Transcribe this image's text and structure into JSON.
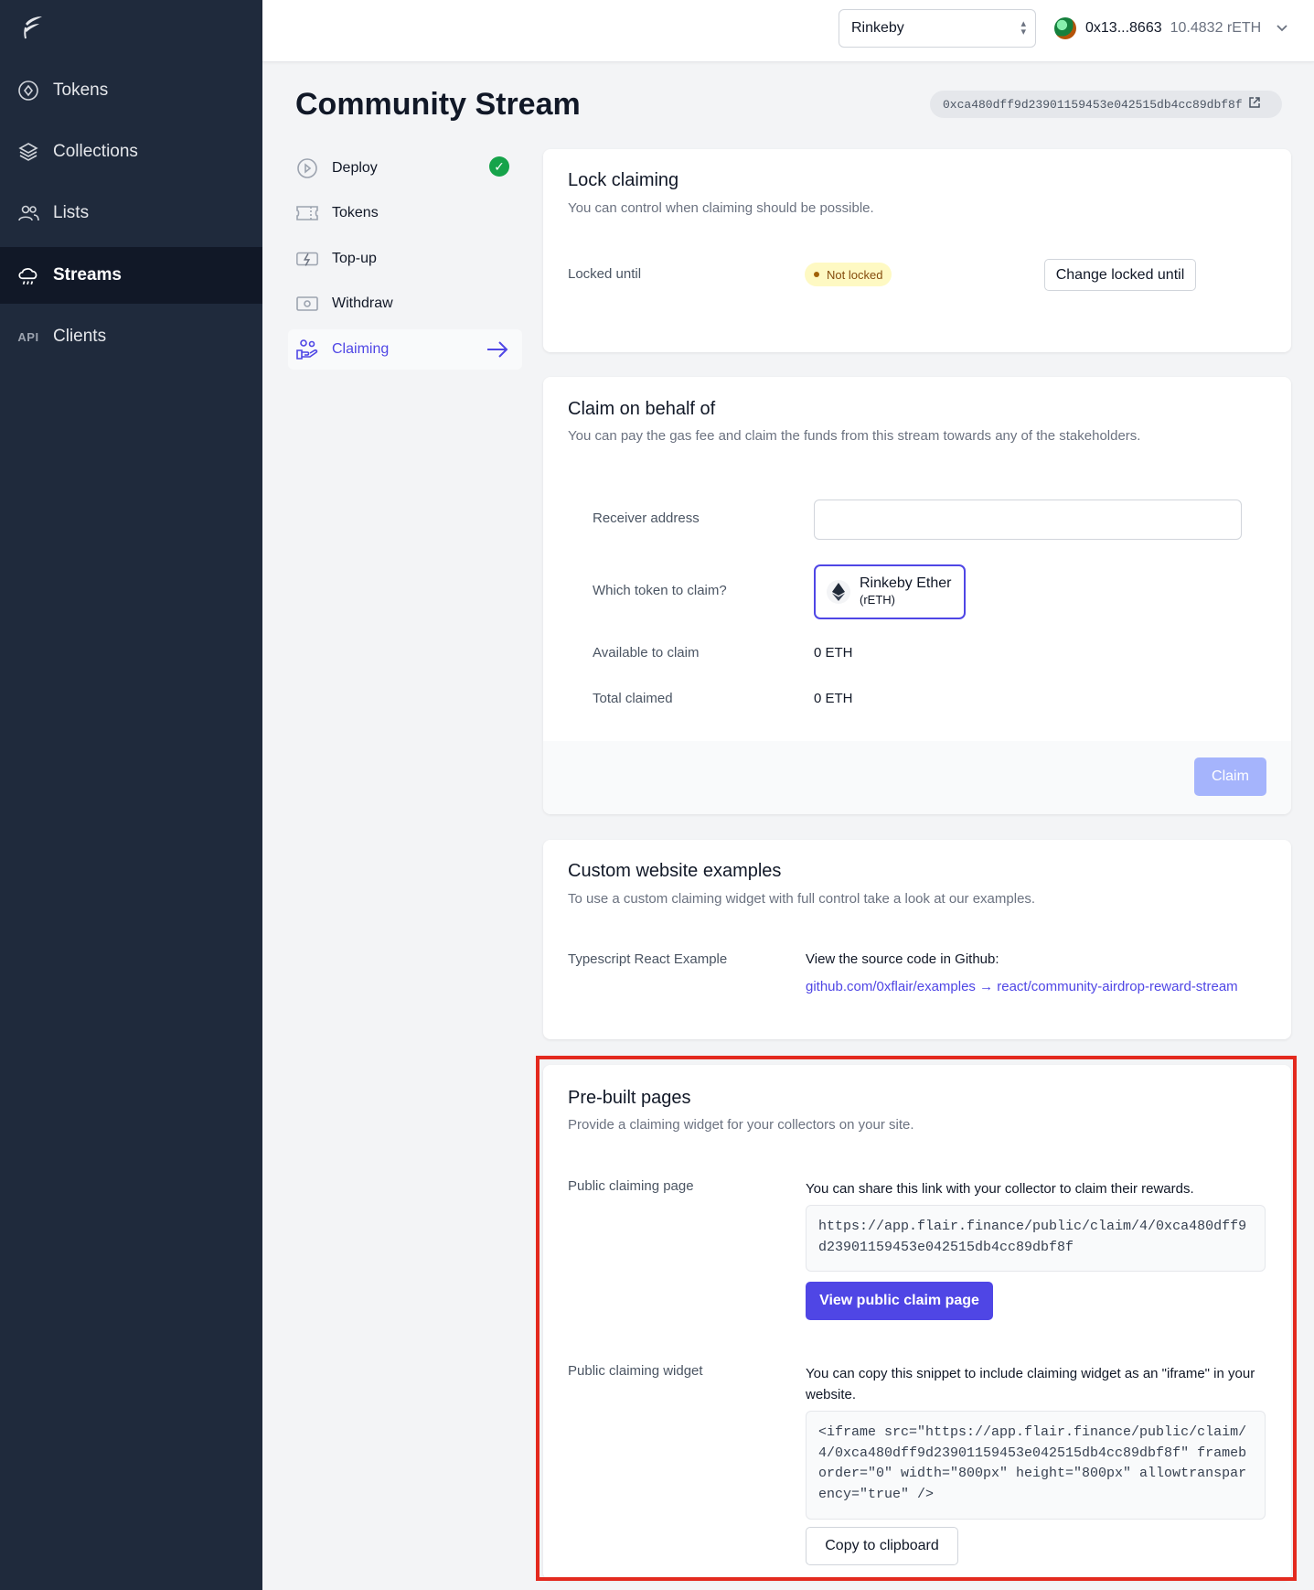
{
  "sidebar": {
    "items": [
      {
        "label": "Tokens",
        "icon": "token-icon"
      },
      {
        "label": "Collections",
        "icon": "layers-icon"
      },
      {
        "label": "Lists",
        "icon": "users-icon"
      },
      {
        "label": "Streams",
        "icon": "cloud-rain-icon",
        "active": true
      },
      {
        "label": "Clients",
        "icon": "api-icon",
        "icon_text": "API"
      }
    ]
  },
  "topbar": {
    "network": "Rinkeby",
    "account_address": "0x13...8663",
    "account_balance": "10.4832 rETH"
  },
  "page": {
    "title": "Community Stream",
    "contract_address": "0xca480dff9d23901159453e042515db4cc89dbf8f"
  },
  "subnav": {
    "items": [
      {
        "label": "Deploy",
        "icon": "play-circle-icon",
        "done": true
      },
      {
        "label": "Tokens",
        "icon": "ticket-icon"
      },
      {
        "label": "Top-up",
        "icon": "bolt-card-icon"
      },
      {
        "label": "Withdraw",
        "icon": "cash-icon"
      },
      {
        "label": "Claiming",
        "icon": "hand-coins-icon",
        "active": true
      }
    ]
  },
  "lock_card": {
    "title": "Lock claiming",
    "subtitle": "You can control when claiming should be possible.",
    "locked_until_label": "Locked until",
    "status": "Not locked",
    "change_button": "Change locked until"
  },
  "claim_card": {
    "title": "Claim on behalf of",
    "subtitle": "You can pay the gas fee and claim the funds from this stream towards any of the stakeholders.",
    "receiver_label": "Receiver address",
    "receiver_value": "",
    "token_label": "Which token to claim?",
    "token_name": "Rinkeby Ether",
    "token_symbol": "(rETH)",
    "available_label": "Available to claim",
    "available_value": "0 ETH",
    "total_label": "Total claimed",
    "total_value": "0 ETH",
    "claim_button": "Claim"
  },
  "examples_card": {
    "title": "Custom website examples",
    "subtitle": "To use a custom claiming widget with full control take a look at our examples.",
    "example_label": "Typescript React Example",
    "source_text": "View the source code in Github:",
    "link": "github.com/0xflair/examples → react/community-airdrop-reward-stream"
  },
  "prebuilt_card": {
    "title": "Pre-built pages",
    "subtitle": "Provide a claiming widget for your collectors on your site.",
    "public_page_label": "Public claiming page",
    "public_page_desc": "You can share this link with your collector to claim their rewards.",
    "public_page_url": "https://app.flair.finance/public/claim/4/0xca480dff9d23901159453e042515db4cc89dbf8f",
    "view_button": "View public claim page",
    "widget_label": "Public claiming widget",
    "widget_desc": "You can copy this snippet to include claiming widget as an \"iframe\" in your website.",
    "widget_snippet": "<iframe src=\"https://app.flair.finance/public/claim/4/0xca480dff9d23901159453e042515db4cc89dbf8f\" frameborder=\"0\" width=\"800px\" height=\"800px\" allowtransparency=\"true\" />",
    "copy_button": "Copy to clipboard"
  },
  "colors": {
    "sidebar_bg": "#1f2a3c",
    "accent": "#4f46e5",
    "highlight_border": "#e3291e"
  }
}
